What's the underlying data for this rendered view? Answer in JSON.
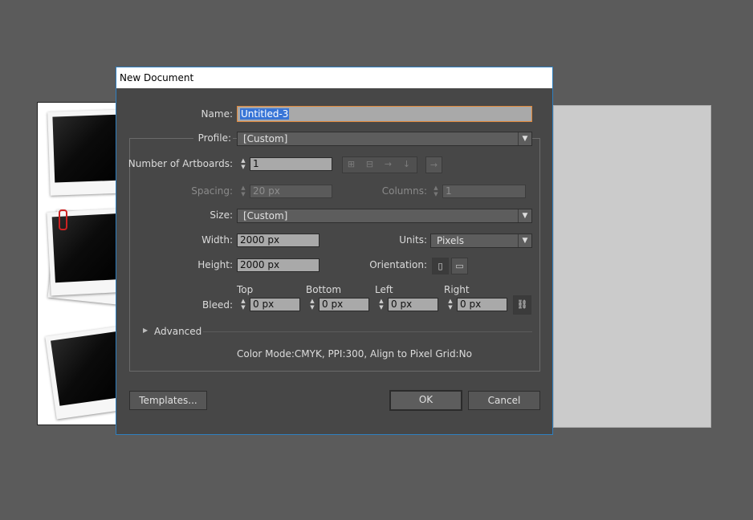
{
  "dialog": {
    "title": "New Document",
    "name_label": "Name:",
    "name_value": "Untitled-3",
    "profile_label": "Profile:",
    "profile_value": "[Custom]",
    "artboards_label": "Number of Artboards:",
    "artboards_value": "1",
    "spacing_label": "Spacing:",
    "spacing_value": "20 px",
    "columns_label": "Columns:",
    "columns_value": "1",
    "size_label": "Size:",
    "size_value": "[Custom]",
    "width_label": "Width:",
    "width_value": "2000 px",
    "units_label": "Units:",
    "units_value": "Pixels",
    "height_label": "Height:",
    "height_value": "2000 px",
    "orientation_label": "Orientation:",
    "bleed_label": "Bleed:",
    "bleed_top_label": "Top",
    "bleed_bottom_label": "Bottom",
    "bleed_left_label": "Left",
    "bleed_right_label": "Right",
    "bleed_top": "0 px",
    "bleed_bottom": "0 px",
    "bleed_left": "0 px",
    "bleed_right": "0 px",
    "advanced_label": "Advanced",
    "summary": "Color Mode:CMYK, PPI:300, Align to Pixel Grid:No",
    "templates_button": "Templates...",
    "ok_button": "OK",
    "cancel_button": "Cancel"
  },
  "colors": {
    "workspace": "#5b5b5b",
    "dialog_bg": "#474747",
    "accent_focus": "#e0883a",
    "selection": "#3875d7"
  }
}
